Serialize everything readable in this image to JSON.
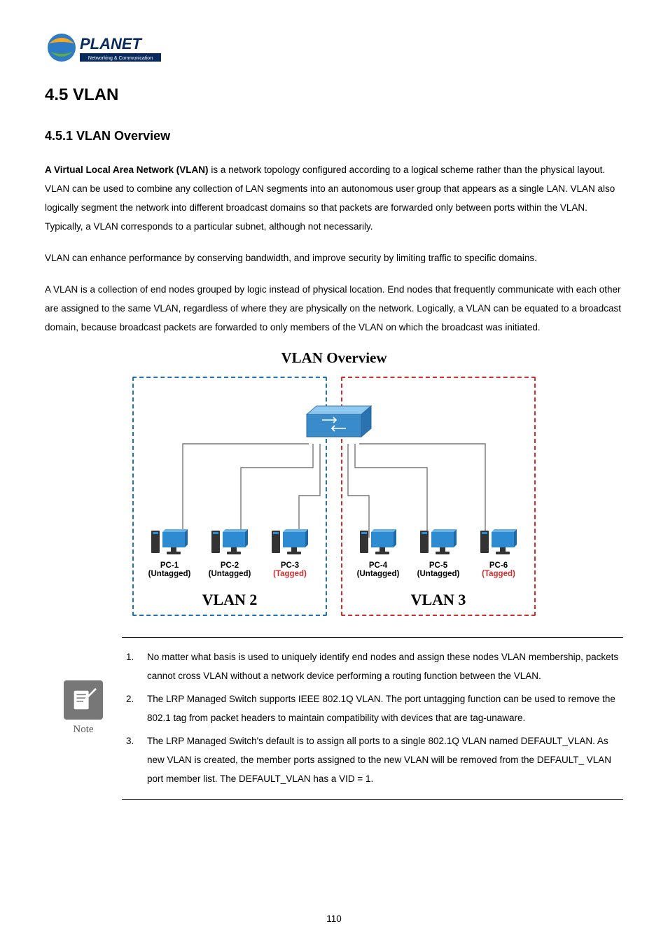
{
  "logo": {
    "brand": "PLANET",
    "tagline": "Networking & Communication"
  },
  "headings": {
    "h1": "4.5 VLAN",
    "h2": "4.5.1 VLAN Overview"
  },
  "paragraphs": {
    "p1_lead": "A Virtual Local Area Network (VLAN)",
    "p1_rest": " is a network topology configured according to a logical scheme rather than the physical layout. VLAN can be used to combine any collection of LAN segments into an autonomous user group that appears as a single LAN. VLAN also logically segment the network into different broadcast domains so that packets are forwarded only between ports within the VLAN. Typically, a VLAN corresponds to a particular subnet, although not necessarily.",
    "p2": "VLAN can enhance performance by conserving bandwidth, and improve security by limiting traffic to specific domains.",
    "p3": "A VLAN is a collection of end nodes grouped by logic instead of physical location. End nodes that frequently communicate with each other are assigned to the same VLAN, regardless of where they are physically on the network. Logically, a VLAN can be equated to a broadcast domain, because broadcast packets are forwarded to only members of the VLAN on which the broadcast was initiated."
  },
  "diagram": {
    "title": "VLAN Overview",
    "vlan2_label": "VLAN 2",
    "vlan3_label": "VLAN 3",
    "pcs": [
      {
        "name": "PC-1",
        "tag": "(Untagged)",
        "tagged": false
      },
      {
        "name": "PC-2",
        "tag": "(Untagged)",
        "tagged": false
      },
      {
        "name": "PC-3",
        "tag": "(Tagged)",
        "tagged": true
      },
      {
        "name": "PC-4",
        "tag": "(Untagged)",
        "tagged": false
      },
      {
        "name": "PC-5",
        "tag": "(Untagged)",
        "tagged": false
      },
      {
        "name": "PC-6",
        "tag": "(Tagged)",
        "tagged": true
      }
    ]
  },
  "note": {
    "label": "Note",
    "items": [
      "No matter what basis is used to uniquely identify end nodes and assign these nodes VLAN membership, packets cannot cross VLAN without a network device performing a routing function between the VLAN.",
      "The LRP Managed Switch supports IEEE 802.1Q VLAN. The port untagging function can be used to remove the 802.1 tag from packet headers to maintain compatibility with devices that are tag-unaware.",
      "The LRP Managed Switch's default is to assign all ports to a single 802.1Q VLAN named DEFAULT_VLAN. As new VLAN is created, the member ports assigned to the new VLAN will be removed from the DEFAULT_ VLAN port member list. The DEFAULT_VLAN has a VID = 1."
    ]
  },
  "page_number": "110"
}
